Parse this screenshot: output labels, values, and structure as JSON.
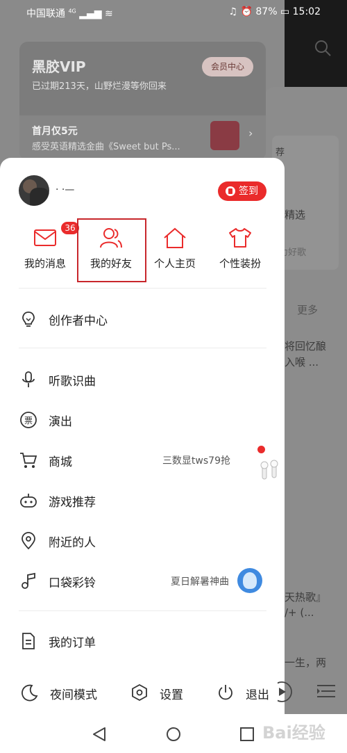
{
  "status_bar": {
    "carrier": "中国联通",
    "network": "4G",
    "battery": "87%",
    "time": "15:02"
  },
  "background": {
    "vip": {
      "logo": "黑胶VIP",
      "expired_text": "已过期213天，山野烂漫等你回来",
      "center_button": "会员中心",
      "offer_title": "首月仅5元",
      "offer_subtitle": "感受英语精选金曲《Sweet but Ps..."
    },
    "right_panel": {
      "recommend_fragment": "荐",
      "pick_fragment": "精选",
      "good_songs_fragment": "力好歌",
      "more": "更多",
      "lyric_1": "将回忆酿",
      "lyric_2": "入喉 ...",
      "hot_song": "天热歌』",
      "hot_song_2": "/+ (...",
      "life": "一生，两"
    }
  },
  "drawer": {
    "username": "·  ·—",
    "signin_label": "签到",
    "quick_actions": [
      {
        "label": "我的消息",
        "icon": "mail-icon",
        "badge": "36"
      },
      {
        "label": "我的好友",
        "icon": "friends-icon"
      },
      {
        "label": "个人主页",
        "icon": "home-icon"
      },
      {
        "label": "个性装扮",
        "icon": "tshirt-icon"
      }
    ],
    "menu": [
      {
        "label": "创作者中心",
        "icon": "lightbulb-icon"
      },
      {
        "label": "听歌识曲",
        "icon": "mic-icon"
      },
      {
        "label": "演出",
        "icon": "ticket-icon"
      },
      {
        "label": "商城",
        "icon": "cart-icon",
        "right_text": "三数显tws79抢"
      },
      {
        "label": "游戏推荐",
        "icon": "gamepad-icon"
      },
      {
        "label": "附近的人",
        "icon": "location-icon"
      },
      {
        "label": "口袋彩铃",
        "icon": "ringtone-icon",
        "right_text": "夏日解暑神曲"
      },
      {
        "label": "我的订单",
        "icon": "order-icon"
      }
    ],
    "bottom": {
      "night_mode": "夜间模式",
      "settings": "设置",
      "logout": "退出"
    }
  },
  "watermark": "Bai经验",
  "colors": {
    "accent_red": "#ea2b2b",
    "highlight_box": "#c8262b"
  }
}
